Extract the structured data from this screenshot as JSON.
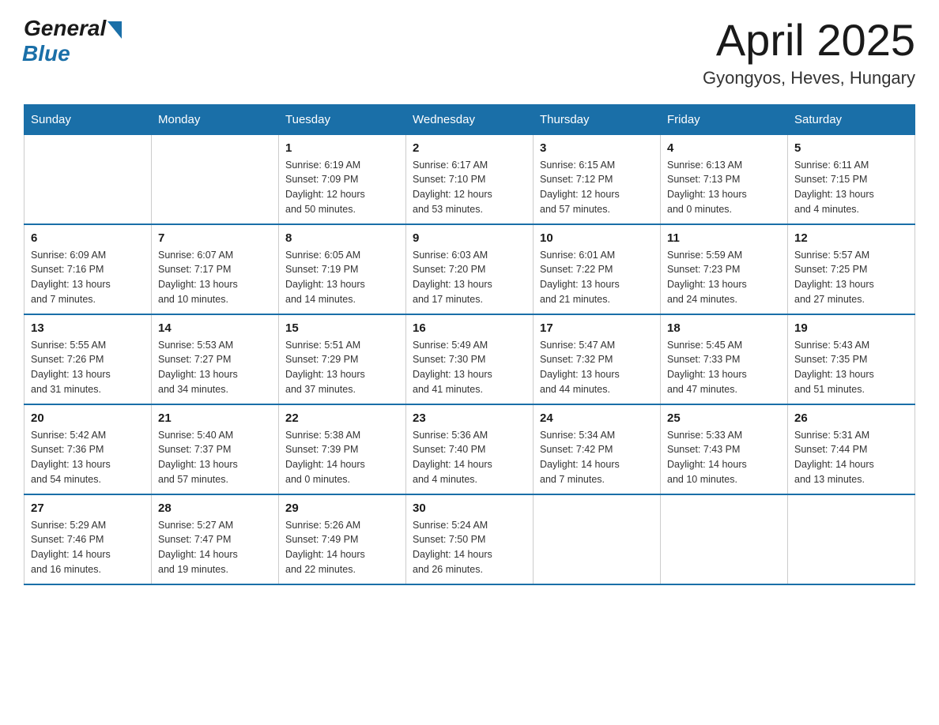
{
  "logo": {
    "general": "General",
    "blue": "Blue"
  },
  "title": "April 2025",
  "location": "Gyongyos, Heves, Hungary",
  "days_of_week": [
    "Sunday",
    "Monday",
    "Tuesday",
    "Wednesday",
    "Thursday",
    "Friday",
    "Saturday"
  ],
  "weeks": [
    [
      {
        "day": "",
        "info": ""
      },
      {
        "day": "",
        "info": ""
      },
      {
        "day": "1",
        "info": "Sunrise: 6:19 AM\nSunset: 7:09 PM\nDaylight: 12 hours\nand 50 minutes."
      },
      {
        "day": "2",
        "info": "Sunrise: 6:17 AM\nSunset: 7:10 PM\nDaylight: 12 hours\nand 53 minutes."
      },
      {
        "day": "3",
        "info": "Sunrise: 6:15 AM\nSunset: 7:12 PM\nDaylight: 12 hours\nand 57 minutes."
      },
      {
        "day": "4",
        "info": "Sunrise: 6:13 AM\nSunset: 7:13 PM\nDaylight: 13 hours\nand 0 minutes."
      },
      {
        "day": "5",
        "info": "Sunrise: 6:11 AM\nSunset: 7:15 PM\nDaylight: 13 hours\nand 4 minutes."
      }
    ],
    [
      {
        "day": "6",
        "info": "Sunrise: 6:09 AM\nSunset: 7:16 PM\nDaylight: 13 hours\nand 7 minutes."
      },
      {
        "day": "7",
        "info": "Sunrise: 6:07 AM\nSunset: 7:17 PM\nDaylight: 13 hours\nand 10 minutes."
      },
      {
        "day": "8",
        "info": "Sunrise: 6:05 AM\nSunset: 7:19 PM\nDaylight: 13 hours\nand 14 minutes."
      },
      {
        "day": "9",
        "info": "Sunrise: 6:03 AM\nSunset: 7:20 PM\nDaylight: 13 hours\nand 17 minutes."
      },
      {
        "day": "10",
        "info": "Sunrise: 6:01 AM\nSunset: 7:22 PM\nDaylight: 13 hours\nand 21 minutes."
      },
      {
        "day": "11",
        "info": "Sunrise: 5:59 AM\nSunset: 7:23 PM\nDaylight: 13 hours\nand 24 minutes."
      },
      {
        "day": "12",
        "info": "Sunrise: 5:57 AM\nSunset: 7:25 PM\nDaylight: 13 hours\nand 27 minutes."
      }
    ],
    [
      {
        "day": "13",
        "info": "Sunrise: 5:55 AM\nSunset: 7:26 PM\nDaylight: 13 hours\nand 31 minutes."
      },
      {
        "day": "14",
        "info": "Sunrise: 5:53 AM\nSunset: 7:27 PM\nDaylight: 13 hours\nand 34 minutes."
      },
      {
        "day": "15",
        "info": "Sunrise: 5:51 AM\nSunset: 7:29 PM\nDaylight: 13 hours\nand 37 minutes."
      },
      {
        "day": "16",
        "info": "Sunrise: 5:49 AM\nSunset: 7:30 PM\nDaylight: 13 hours\nand 41 minutes."
      },
      {
        "day": "17",
        "info": "Sunrise: 5:47 AM\nSunset: 7:32 PM\nDaylight: 13 hours\nand 44 minutes."
      },
      {
        "day": "18",
        "info": "Sunrise: 5:45 AM\nSunset: 7:33 PM\nDaylight: 13 hours\nand 47 minutes."
      },
      {
        "day": "19",
        "info": "Sunrise: 5:43 AM\nSunset: 7:35 PM\nDaylight: 13 hours\nand 51 minutes."
      }
    ],
    [
      {
        "day": "20",
        "info": "Sunrise: 5:42 AM\nSunset: 7:36 PM\nDaylight: 13 hours\nand 54 minutes."
      },
      {
        "day": "21",
        "info": "Sunrise: 5:40 AM\nSunset: 7:37 PM\nDaylight: 13 hours\nand 57 minutes."
      },
      {
        "day": "22",
        "info": "Sunrise: 5:38 AM\nSunset: 7:39 PM\nDaylight: 14 hours\nand 0 minutes."
      },
      {
        "day": "23",
        "info": "Sunrise: 5:36 AM\nSunset: 7:40 PM\nDaylight: 14 hours\nand 4 minutes."
      },
      {
        "day": "24",
        "info": "Sunrise: 5:34 AM\nSunset: 7:42 PM\nDaylight: 14 hours\nand 7 minutes."
      },
      {
        "day": "25",
        "info": "Sunrise: 5:33 AM\nSunset: 7:43 PM\nDaylight: 14 hours\nand 10 minutes."
      },
      {
        "day": "26",
        "info": "Sunrise: 5:31 AM\nSunset: 7:44 PM\nDaylight: 14 hours\nand 13 minutes."
      }
    ],
    [
      {
        "day": "27",
        "info": "Sunrise: 5:29 AM\nSunset: 7:46 PM\nDaylight: 14 hours\nand 16 minutes."
      },
      {
        "day": "28",
        "info": "Sunrise: 5:27 AM\nSunset: 7:47 PM\nDaylight: 14 hours\nand 19 minutes."
      },
      {
        "day": "29",
        "info": "Sunrise: 5:26 AM\nSunset: 7:49 PM\nDaylight: 14 hours\nand 22 minutes."
      },
      {
        "day": "30",
        "info": "Sunrise: 5:24 AM\nSunset: 7:50 PM\nDaylight: 14 hours\nand 26 minutes."
      },
      {
        "day": "",
        "info": ""
      },
      {
        "day": "",
        "info": ""
      },
      {
        "day": "",
        "info": ""
      }
    ]
  ]
}
